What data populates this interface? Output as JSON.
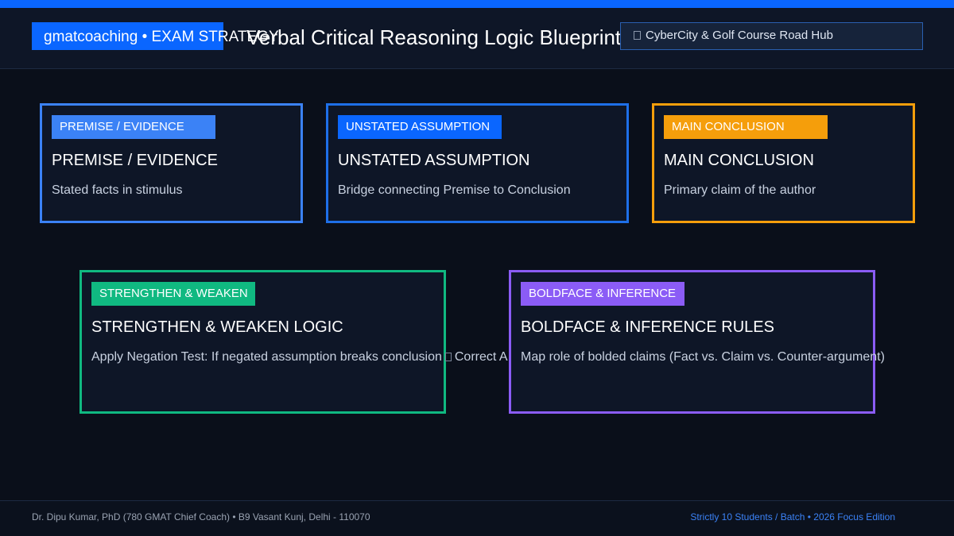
{
  "header": {
    "brand": "gmatcoaching • EXAM STRATEGY",
    "title": "Verbal Critical Reasoning Logic Blueprint",
    "location": "CyberCity & Golf Course Road Hub",
    "location_icon": "location-pin-icon"
  },
  "cards": {
    "premise": {
      "tag": "PREMISE / EVIDENCE",
      "title": "PREMISE / EVIDENCE",
      "desc": "Stated facts in stimulus",
      "color": "#3b82f6"
    },
    "assumption": {
      "tag": "UNSTATED ASSUMPTION",
      "title": "UNSTATED ASSUMPTION",
      "desc": "Bridge connecting Premise to Conclusion",
      "color": "#0a66ff"
    },
    "conclusion": {
      "tag": "MAIN CONCLUSION",
      "title": "MAIN CONCLUSION",
      "desc": "Primary claim of the author",
      "color": "#f59e0b"
    },
    "strengthen": {
      "tag": "STRENGTHEN & WEAKEN",
      "title": "STRENGTHEN & WEAKEN LOGIC",
      "desc_before": "Apply Negation Test: If negated assumption breaks conclusion",
      "desc_after": "Correct A",
      "icon": "arrow-icon",
      "color": "#10b981"
    },
    "boldface": {
      "tag": "BOLDFACE & INFERENCE",
      "title": "BOLDFACE & INFERENCE RULES",
      "desc": "Map role of bolded claims (Fact vs. Claim vs. Counter-argument)",
      "color": "#8b5cf6"
    }
  },
  "footer": {
    "left": "Dr. Dipu Kumar, PhD (780 GMAT Chief Coach) • B9 Vasant Kunj, Delhi - 110070",
    "right": "Strictly 10 Students / Batch • 2026 Focus Edition"
  },
  "colors": {
    "accent": "#0a66ff",
    "background": "#0a0f1a"
  }
}
